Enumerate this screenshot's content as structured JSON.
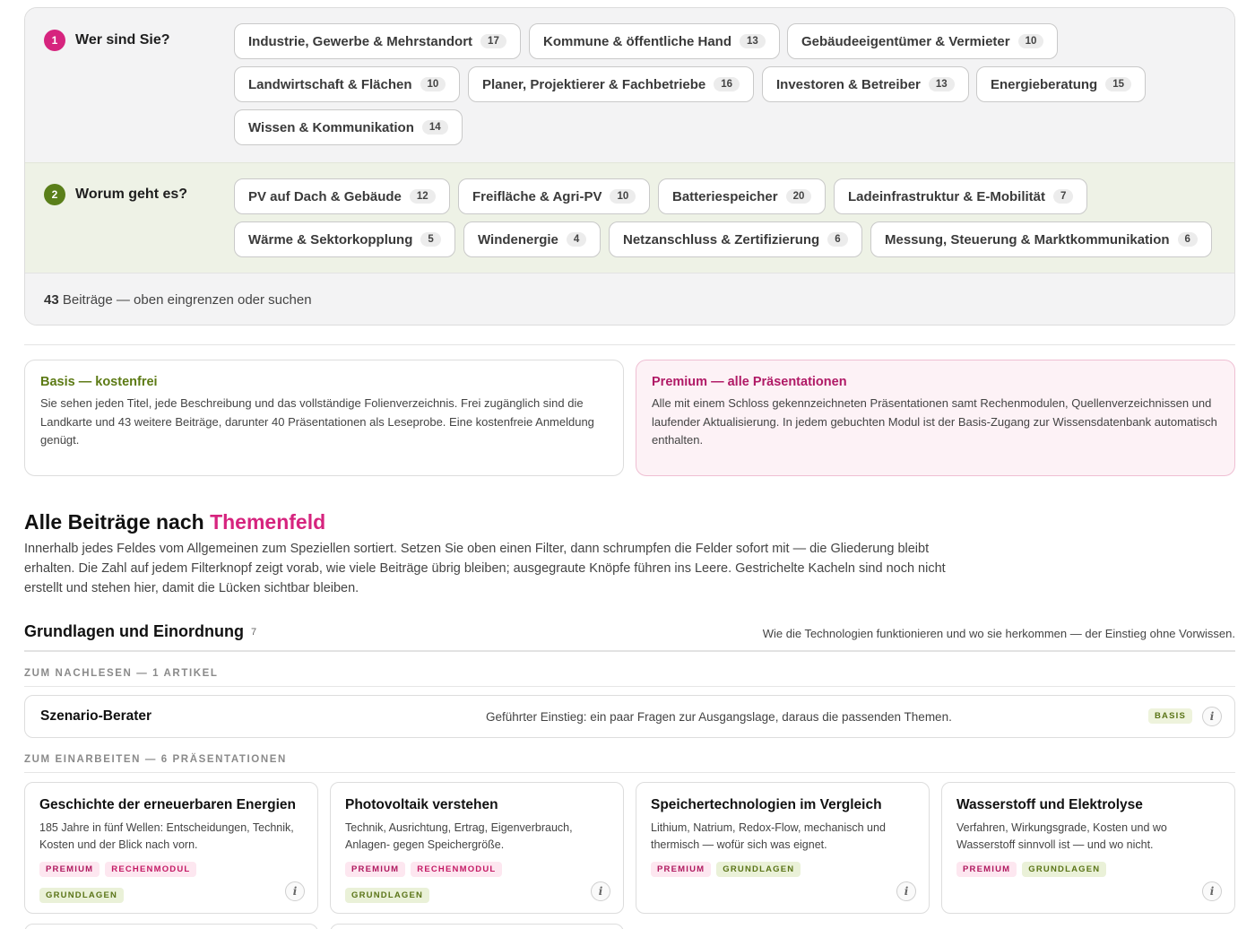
{
  "filters": {
    "step1": {
      "num": "1",
      "label": "Wer sind Sie?"
    },
    "step2": {
      "num": "2",
      "label": "Worum geht es?"
    },
    "audience": [
      {
        "label": "Industrie, Gewerbe & Mehrstandort",
        "count": "17"
      },
      {
        "label": "Kommune & öffentliche Hand",
        "count": "13"
      },
      {
        "label": "Gebäudeeigentümer & Vermieter",
        "count": "10"
      },
      {
        "label": "Landwirtschaft & Flächen",
        "count": "10"
      },
      {
        "label": "Planer, Projektierer & Fachbetriebe",
        "count": "16"
      },
      {
        "label": "Investoren & Betreiber",
        "count": "13"
      },
      {
        "label": "Energieberatung",
        "count": "15"
      },
      {
        "label": "Wissen & Kommunikation",
        "count": "14"
      }
    ],
    "topics": [
      {
        "label": "PV auf Dach & Gebäude",
        "count": "12"
      },
      {
        "label": "Freifläche & Agri-PV",
        "count": "10"
      },
      {
        "label": "Batteriespeicher",
        "count": "20"
      },
      {
        "label": "Ladeinfrastruktur & E-Mobilität",
        "count": "7"
      },
      {
        "label": "Wärme & Sektorkopplung",
        "count": "5"
      },
      {
        "label": "Windenergie",
        "count": "4"
      },
      {
        "label": "Netzanschluss & Zertifizierung",
        "count": "6"
      },
      {
        "label": "Messung, Steuerung & Marktkommunikation",
        "count": "6"
      }
    ],
    "result_count": "43",
    "result_text": " Beiträge — oben eingrenzen oder suchen"
  },
  "tiers": {
    "basis": {
      "title": "Basis — kostenfrei",
      "text": "Sie sehen jeden Titel, jede Beschreibung und das vollständige Folienverzeichnis. Frei zugänglich sind die Landkarte und 43 weitere Beiträge, darunter 40 Präsentationen als Leseprobe. Eine kostenfreie Anmeldung genügt."
    },
    "premium": {
      "title": "Premium — alle Präsentationen",
      "text": "Alle mit einem Schloss gekennzeichneten Präsentationen samt Rechenmodulen, Quellenverzeichnissen und laufender Aktualisierung. In jedem gebuchten Modul ist der Basis-Zugang zur Wissensdatenbank automatisch enthalten."
    }
  },
  "heading": {
    "prefix": "Alle Beiträge nach ",
    "accent": "Themenfeld",
    "intro": "Innerhalb jedes Feldes vom Allgemeinen zum Speziellen sortiert. Setzen Sie oben einen Filter, dann schrumpfen die Felder sofort mit — die Gliederung bleibt erhalten. Die Zahl auf jedem Filterknopf zeigt vorab, wie viele Beiträge übrig bleiben; ausgegraute Knöpfe führen ins Leere. Gestrichelte Kacheln sind noch nicht erstellt und stehen hier, damit die Lücken sichtbar bleiben."
  },
  "section": {
    "title": "Grundlagen und Einordnung",
    "count": "7",
    "description": "Wie die Technologien funktionieren und wo sie herkommen — der Einstieg ohne Vorwissen.",
    "group1_label": "ZUM NACHLESEN — 1 ARTIKEL",
    "group2_label": "ZUM EINARBEITEN — 6 PRÄSENTATIONEN",
    "article": {
      "title": "Szenario-Berater",
      "description": "Geführter Einstieg: ein paar Fragen zur Ausgangslage, daraus die passenden Themen.",
      "tag": "BASIS"
    },
    "cards": [
      {
        "title": "Geschichte der erneuerbaren Energien",
        "description": "185 Jahre in fünf Wellen: Entscheidungen, Technik, Kosten und der Blick nach vorn.",
        "tag1": "PREMIUM",
        "tag2": "RECHENMODUL",
        "tag3": "GRUNDLAGEN"
      },
      {
        "title": "Photovoltaik verstehen",
        "description": "Technik, Ausrichtung, Ertrag, Eigenverbrauch, Anlagen- gegen Speichergröße.",
        "tag1": "PREMIUM",
        "tag2": "RECHENMODUL",
        "tag3": "GRUNDLAGEN"
      },
      {
        "title": "Speichertechnologien im Vergleich",
        "description": "Lithium, Natrium, Redox-Flow, mechanisch und thermisch — wofür sich was eignet.",
        "tag1": "PREMIUM",
        "tag2": "GRUNDLAGEN"
      },
      {
        "title": "Wasserstoff und Elektrolyse",
        "description": "Verfahren, Wirkungsgrade, Kosten und wo Wasserstoff sinnvoll ist — und wo nicht.",
        "tag1": "PREMIUM",
        "tag2": "GRUNDLAGEN"
      }
    ],
    "info_symbol": "i"
  }
}
